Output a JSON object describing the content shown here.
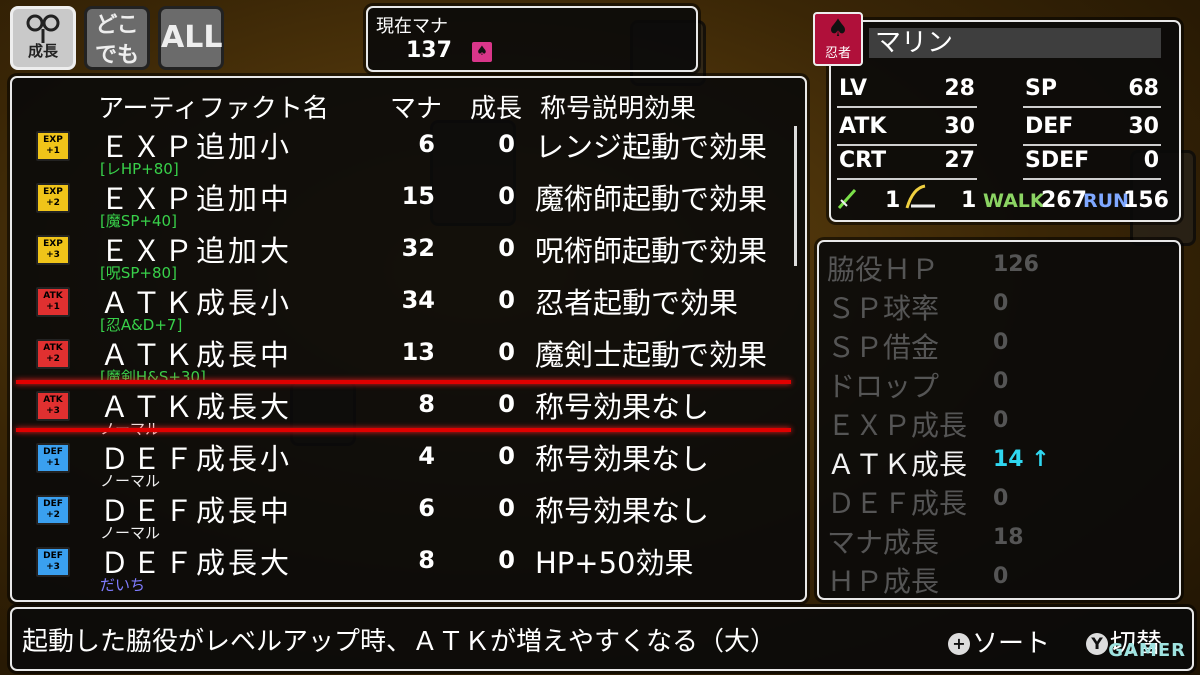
{
  "top_buttons": [
    {
      "id": "growth",
      "label": "成長",
      "active": true,
      "icon": "growth-icon"
    },
    {
      "id": "anywhere",
      "label": "どこでも",
      "line1": "どこ",
      "line2": "でも",
      "active": false
    },
    {
      "id": "all",
      "label": "ALL",
      "active": false
    }
  ],
  "mana": {
    "label": "現在マナ",
    "value": "137",
    "icon": "mana-crest-icon"
  },
  "list": {
    "headers": {
      "name": "アーティファクト名",
      "mana": "マナ",
      "growth": "成長",
      "title_effect": "称号説明効果"
    },
    "rows": [
      {
        "icon_top": "EXP",
        "icon_bottom": "+1",
        "icon_color": "#f0c419",
        "name": "ＥＸＰ追加小",
        "sub": "[レHP+80]",
        "sub_color": "green",
        "mana": "6",
        "growth": "0",
        "desc": "レンジ起動で効果"
      },
      {
        "icon_top": "EXP",
        "icon_bottom": "+2",
        "icon_color": "#f0c419",
        "name": "ＥＸＰ追加中",
        "sub": "[魔SP+40]",
        "sub_color": "green",
        "mana": "15",
        "growth": "0",
        "desc": "魔術師起動で効果"
      },
      {
        "icon_top": "EXP",
        "icon_bottom": "+3",
        "icon_color": "#f0c419",
        "name": "ＥＸＰ追加大",
        "sub": "[呪SP+80]",
        "sub_color": "green",
        "mana": "32",
        "growth": "0",
        "desc": "呪術師起動で効果"
      },
      {
        "icon_top": "ATK",
        "icon_bottom": "+1",
        "icon_color": "#e03030",
        "name": "ＡＴＫ成長小",
        "sub": "[忍A&D+7]",
        "sub_color": "green",
        "mana": "34",
        "growth": "0",
        "desc": "忍者起動で効果"
      },
      {
        "icon_top": "ATK",
        "icon_bottom": "+2",
        "icon_color": "#e03030",
        "name": "ＡＴＫ成長中",
        "sub": "[魔剣H&S+30]",
        "sub_color": "green",
        "mana": "13",
        "growth": "0",
        "desc": "魔剣士起動で効果"
      },
      {
        "icon_top": "ATK",
        "icon_bottom": "+3",
        "icon_color": "#e03030",
        "name": "ＡＴＫ成長大",
        "sub": "ノーマル",
        "sub_color": "white",
        "mana": "8",
        "growth": "0",
        "desc": "称号効果なし",
        "selected": true
      },
      {
        "icon_top": "DEF",
        "icon_bottom": "+1",
        "icon_color": "#3aa0f0",
        "name": "ＤＥＦ成長小",
        "sub": "ノーマル",
        "sub_color": "white",
        "mana": "4",
        "growth": "0",
        "desc": "称号効果なし"
      },
      {
        "icon_top": "DEF",
        "icon_bottom": "+2",
        "icon_color": "#3aa0f0",
        "name": "ＤＥＦ成長中",
        "sub": "ノーマル",
        "sub_color": "white",
        "mana": "6",
        "growth": "0",
        "desc": "称号効果なし"
      },
      {
        "icon_top": "DEF",
        "icon_bottom": "+3",
        "icon_color": "#3aa0f0",
        "name": "ＤＥＦ成長大",
        "sub": "だいち",
        "sub_color": "blue",
        "mana": "8",
        "growth": "0",
        "desc": "HP+50効果"
      }
    ]
  },
  "character": {
    "job": "忍者",
    "name": "マリン",
    "stats": {
      "lv": {
        "label": "LV",
        "value": "28"
      },
      "sp": {
        "label": "SP",
        "value": "68"
      },
      "atk": {
        "label": "ATK",
        "value": "30"
      },
      "def": {
        "label": "DEF",
        "value": "30"
      },
      "crt": {
        "label": "CRT",
        "value": "27"
      },
      "sdef": {
        "label": "SDEF",
        "value": "0"
      }
    },
    "weapon1_count": "1",
    "weapon2_count": "1",
    "walk_label": "WALK",
    "walk_value": "267",
    "run_label": "RUN",
    "run_value": "156"
  },
  "bonus": [
    {
      "label": "脇役ＨＰ",
      "value": "126",
      "active": false
    },
    {
      "label": "ＳＰ球率",
      "value": "0",
      "active": false
    },
    {
      "label": "ＳＰ借金",
      "value": "0",
      "active": false
    },
    {
      "label": "ドロップ",
      "value": "0",
      "active": false
    },
    {
      "label": "ＥＸＰ成長",
      "value": "0",
      "active": false
    },
    {
      "label": "ＡＴＫ成長",
      "value": "14 ↑",
      "active": true
    },
    {
      "label": "ＤＥＦ成長",
      "value": "0",
      "active": false
    },
    {
      "label": "マナ成長",
      "value": "18",
      "active": false
    },
    {
      "label": "ＨＰ成長",
      "value": "0",
      "active": false
    }
  ],
  "description": "起動した脇役がレベルアップ時、ＡＴＫが増えやすくなる（大）",
  "hints": [
    {
      "button": "+",
      "label": "ソート"
    },
    {
      "button": "Y",
      "label": "切替"
    }
  ],
  "watermark": "GAMER"
}
